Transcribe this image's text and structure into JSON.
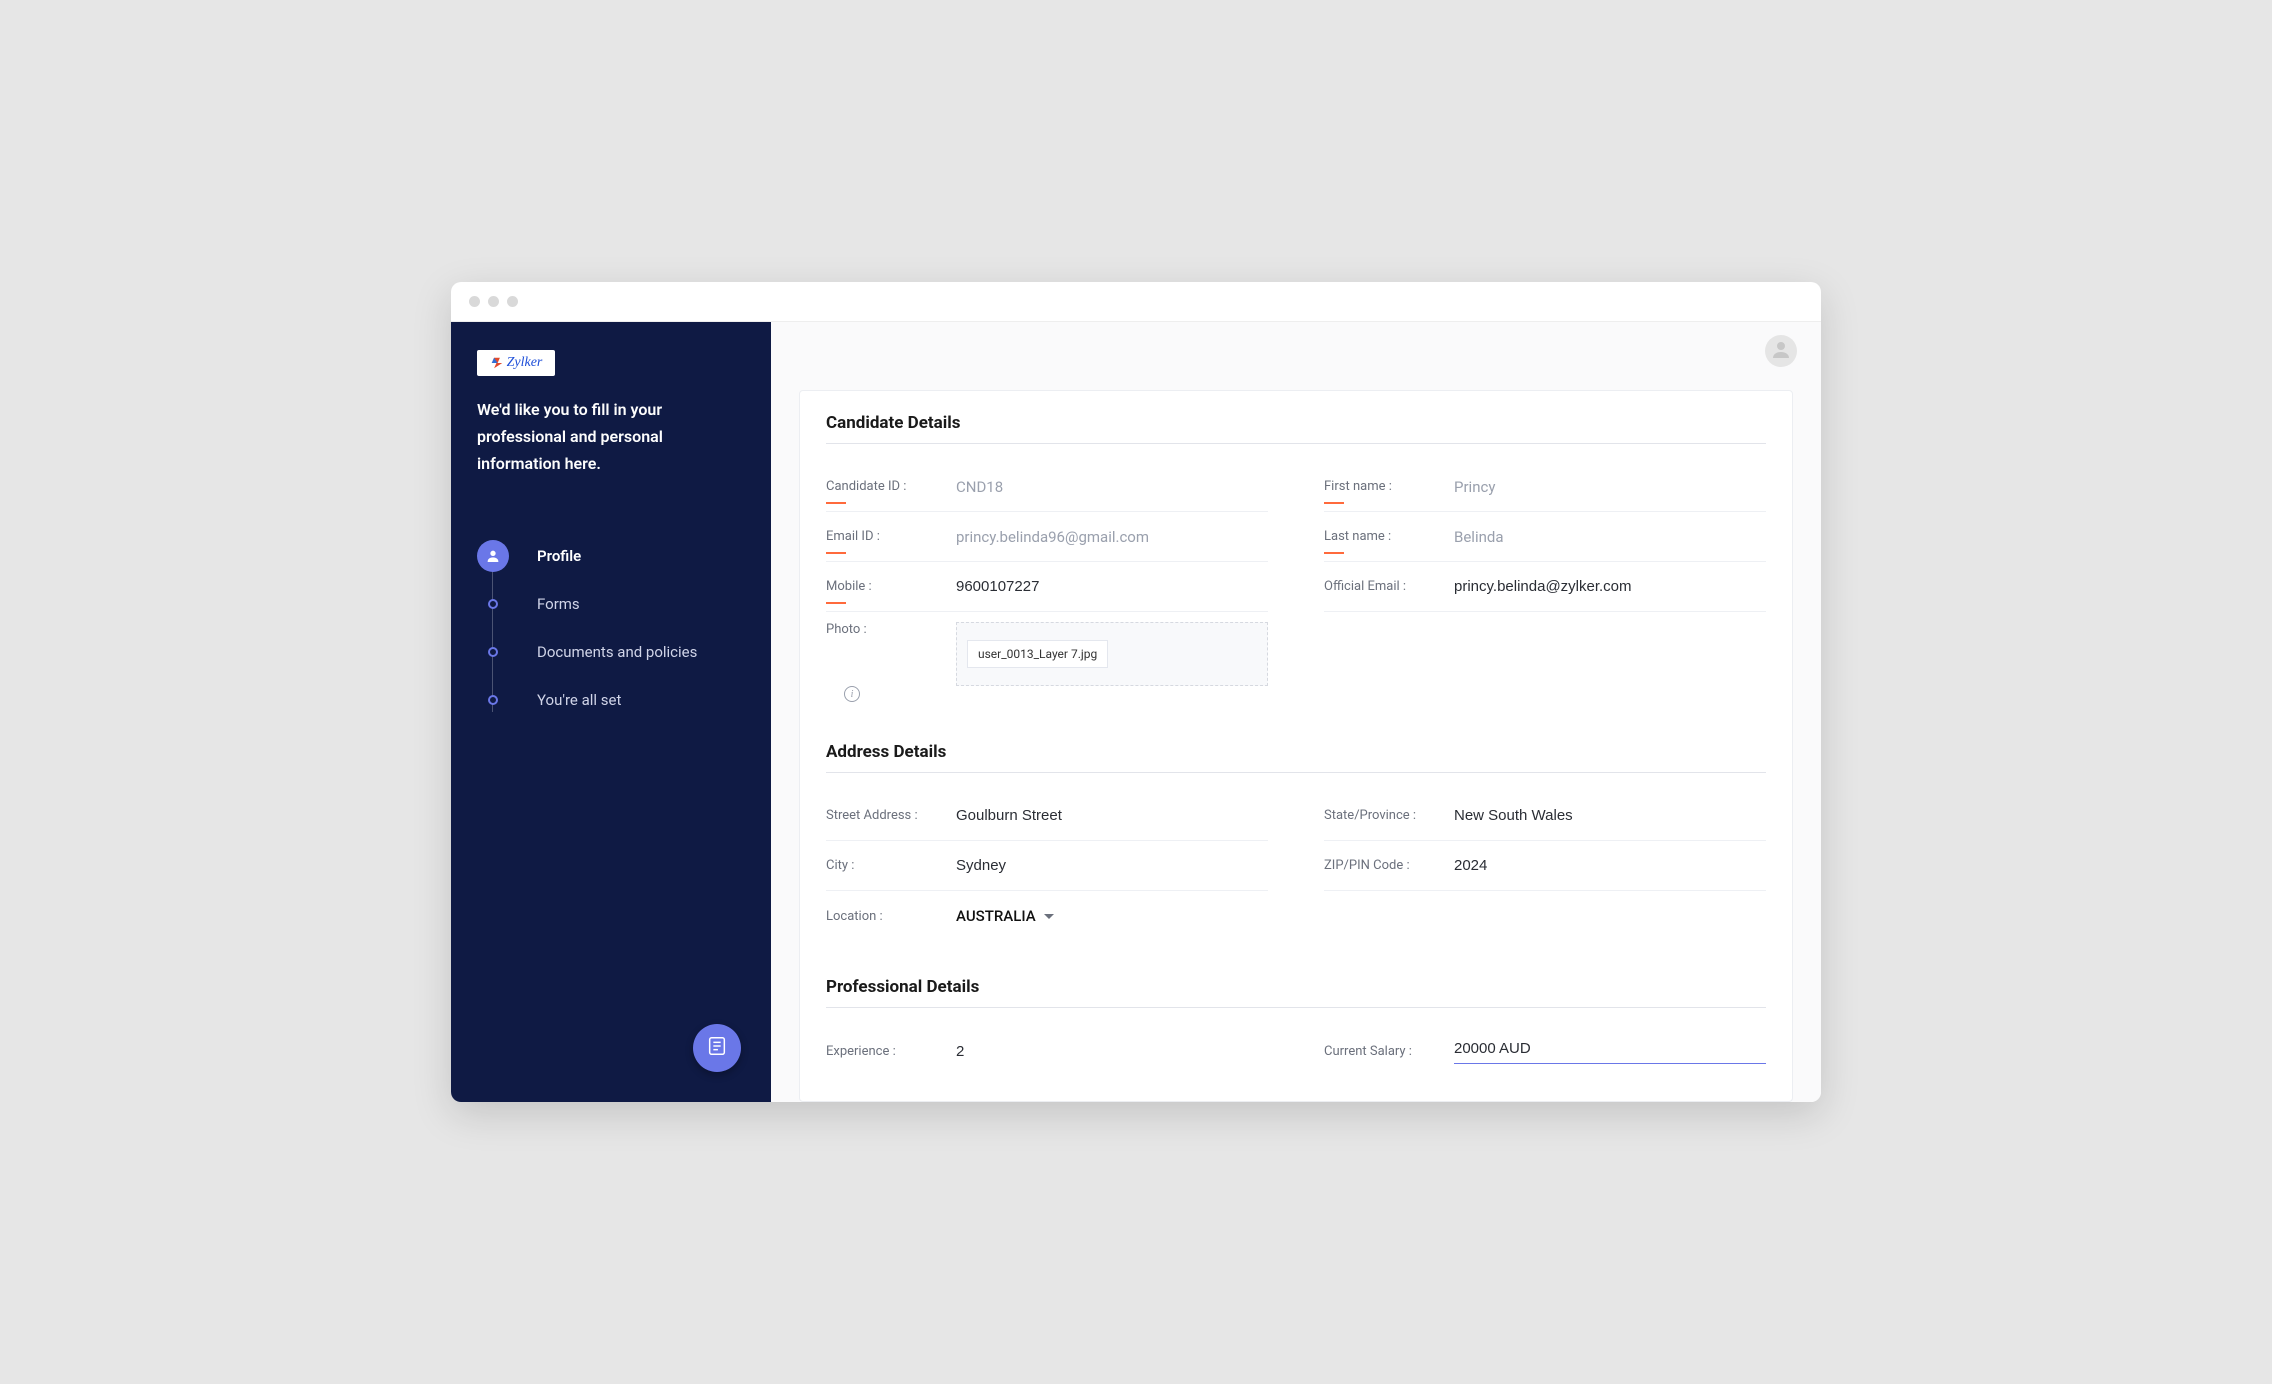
{
  "brand": {
    "name": "Zylker"
  },
  "sidebar": {
    "intro": "We'd like you to fill in your professional and personal information here.",
    "items": [
      {
        "label": "Profile",
        "active": true
      },
      {
        "label": "Forms"
      },
      {
        "label": "Documents and policies"
      },
      {
        "label": "You're all set"
      }
    ]
  },
  "sections": {
    "candidate_title": "Candidate Details",
    "address_title": "Address Details",
    "professional_title": "Professional Details"
  },
  "candidate": {
    "candidate_id_label": "Candidate ID :",
    "candidate_id": "CND18",
    "first_name_label": "First name :",
    "first_name": "Princy",
    "email_id_label": "Email ID :",
    "email_id": "princy.belinda96@gmail.com",
    "last_name_label": "Last name :",
    "last_name": "Belinda",
    "mobile_label": "Mobile :",
    "mobile": "9600107227",
    "official_email_label": "Official Email :",
    "official_email": "princy.belinda@zylker.com",
    "photo_label": "Photo :",
    "photo_filename": "user_0013_Layer 7.jpg"
  },
  "address": {
    "street_label": "Street Address :",
    "street": "Goulburn Street",
    "state_label": "State/Province :",
    "state": "New South Wales",
    "city_label": "City :",
    "city": "Sydney",
    "zip_label": "ZIP/PIN Code :",
    "zip": "2024",
    "location_label": "Location :",
    "location": "AUSTRALIA"
  },
  "professional": {
    "experience_label": "Experience :",
    "experience": "2",
    "salary_label": "Current Salary :",
    "salary": "20000 AUD"
  }
}
